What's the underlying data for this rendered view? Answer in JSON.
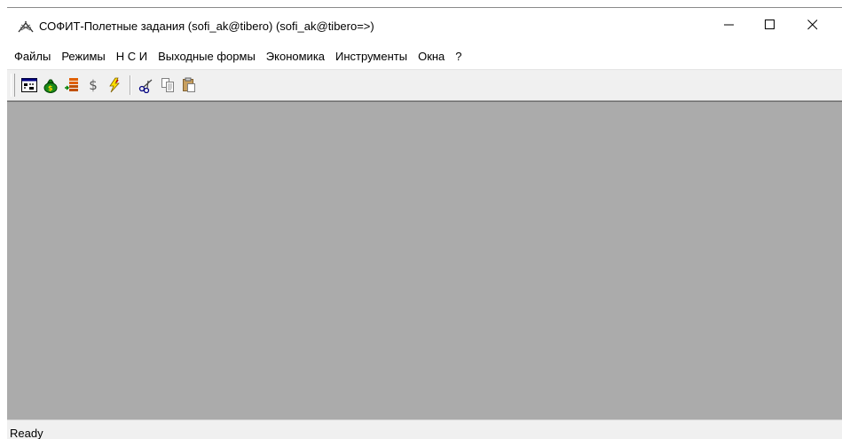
{
  "window": {
    "title": "СОФИТ-Полетные задания (sofi_ak@tibero) (sofi_ak@tibero=>)",
    "app_icon": "app-logo-icon",
    "controls": [
      "minimize-icon",
      "maximize-icon",
      "close-icon"
    ]
  },
  "menu": {
    "items": [
      "Файлы",
      "Режимы",
      "Н С И",
      "Выходные формы",
      "Экономика",
      "Инструменты",
      "Окна",
      "?"
    ]
  },
  "toolbar": {
    "buttons": [
      {
        "icon": "calendar-grid-icon"
      },
      {
        "icon": "money-bag-icon"
      },
      {
        "icon": "stack-list-icon"
      },
      {
        "icon": "dollar-icon",
        "glyph": "$"
      },
      {
        "icon": "lightning-icon"
      },
      {
        "icon": "scissors-icon"
      },
      {
        "icon": "copy-icon"
      },
      {
        "icon": "paste-icon"
      }
    ]
  },
  "status": {
    "text": "Ready"
  },
  "colors": {
    "client_background": "#ababab",
    "toolbar_background": "#f0f0f0"
  }
}
